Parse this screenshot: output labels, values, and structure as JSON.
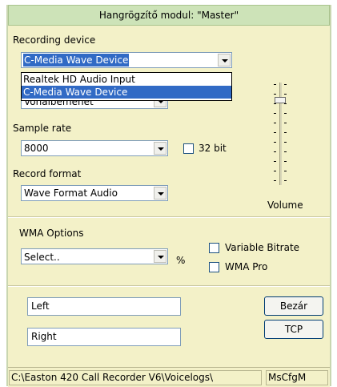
{
  "window": {
    "title": "Hangrögzítő modul: \"Master\""
  },
  "recording": {
    "device_label": "Recording device",
    "device_value": "C-Media Wave Device",
    "device_options": [
      "Realtek HD Audio Input",
      "C-Media Wave Device"
    ],
    "input_value": "Vonalbemenet"
  },
  "sample": {
    "label": "Sample rate",
    "value": "8000",
    "bit32_label": "32 bit"
  },
  "format": {
    "label": "Record format",
    "value": "Wave Format Audio"
  },
  "volume": {
    "label": "Volume",
    "level": 0.85
  },
  "wma": {
    "label": "WMA Options",
    "select_value": "Select..",
    "percent": "%",
    "variable_bitrate": "Variable Bitrate",
    "wma_pro": "WMA Pro"
  },
  "channels": {
    "left": "Left",
    "right": "Right"
  },
  "buttons": {
    "close": "Bezár",
    "tcp": "TCP"
  },
  "status": {
    "path": "C:\\Easton 420 Call Recorder V6\\Voicelogs\\",
    "config": "MsCfgM"
  }
}
